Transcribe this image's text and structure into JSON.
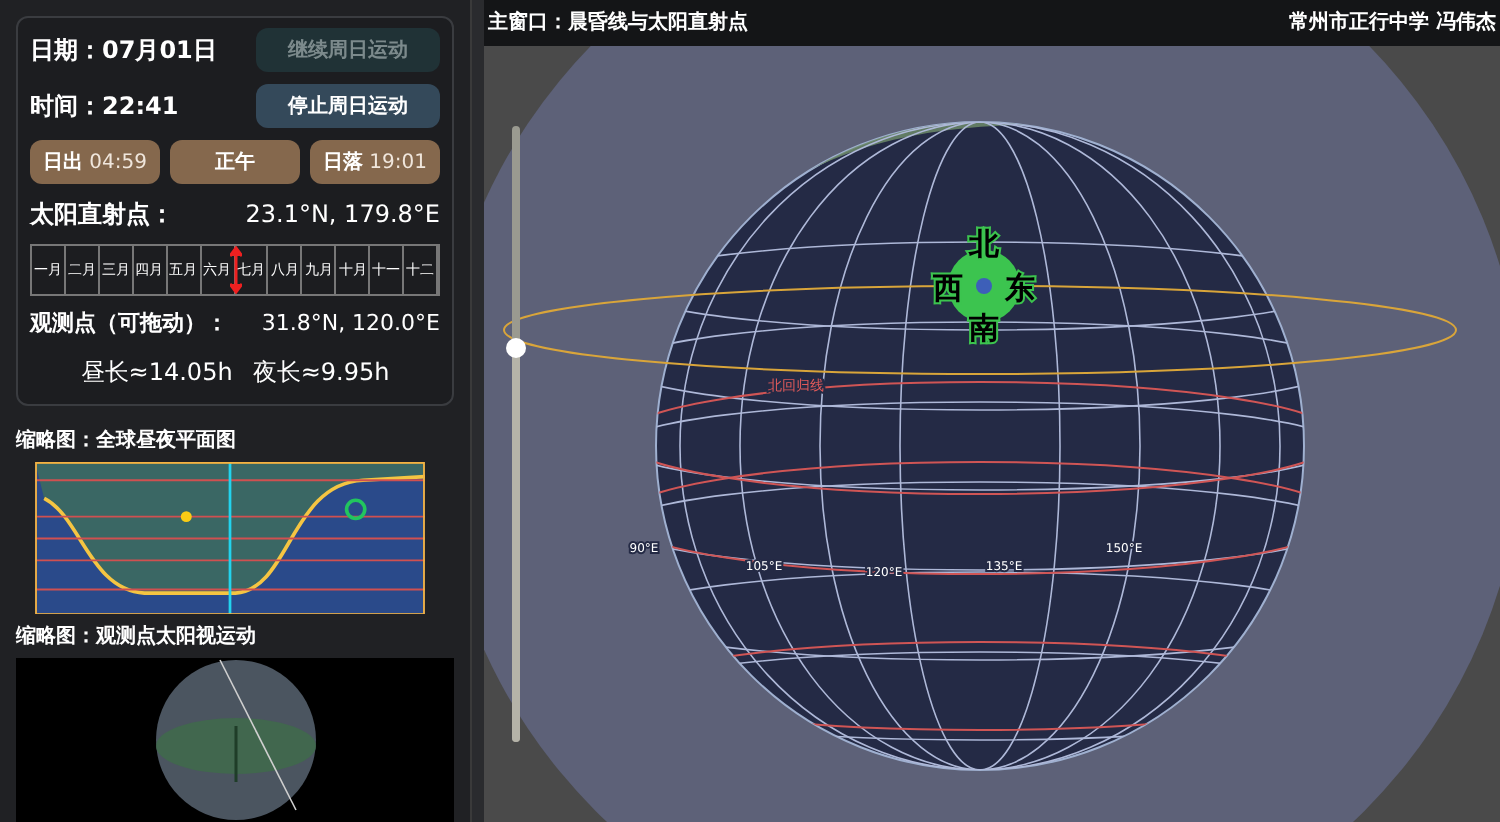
{
  "controls": {
    "date_label": "日期：",
    "date": "07月01日",
    "time_label": "时间：",
    "time": "22:41",
    "buttons": [
      {
        "label": "继续周日运动",
        "disabled": true
      },
      {
        "label": "停止周日运动",
        "disabled": false
      }
    ]
  },
  "sun_buttons": [
    {
      "label": "日出",
      "time": "04:59"
    },
    {
      "label": "正午"
    },
    {
      "label": "日落",
      "time": "19:01"
    }
  ],
  "subsolar": {
    "label": "太阳直射点：",
    "value": "23.1°N, 179.8°E"
  },
  "months": {
    "items": [
      "一月",
      "二月",
      "三月",
      "四月",
      "五月",
      "六月",
      "七月",
      "八月",
      "九月",
      "十月",
      "十一",
      "十二"
    ],
    "level": 0.5
  },
  "observer": {
    "label": "观测点（可拖动）：",
    "value": "31.8°N, 120.0°E"
  },
  "day_length": "昼长≈14.05h",
  "night_length": "夜长≈9.95h",
  "thumbnails": [
    {
      "title": "缩略图：全球昼夜平面图"
    },
    {
      "title": "缩略图：观测点太阳视运动"
    }
  ],
  "main": {
    "title": "主窗口：晨昏线与太阳直射点",
    "author": "常州市正行中学 冯伟杰",
    "zoom_slider": {
      "level": 0.64
    },
    "compass": [
      {
        "kind": "north",
        "label": "北"
      },
      {
        "kind": "west",
        "label": "西"
      },
      {
        "kind": "east",
        "label": "东"
      },
      {
        "kind": "south",
        "label": "南"
      }
    ],
    "tropic_label": "北回归线",
    "longitudes": [
      "90°E",
      "105°E",
      "120°E",
      "135°E",
      "150°E"
    ]
  }
}
